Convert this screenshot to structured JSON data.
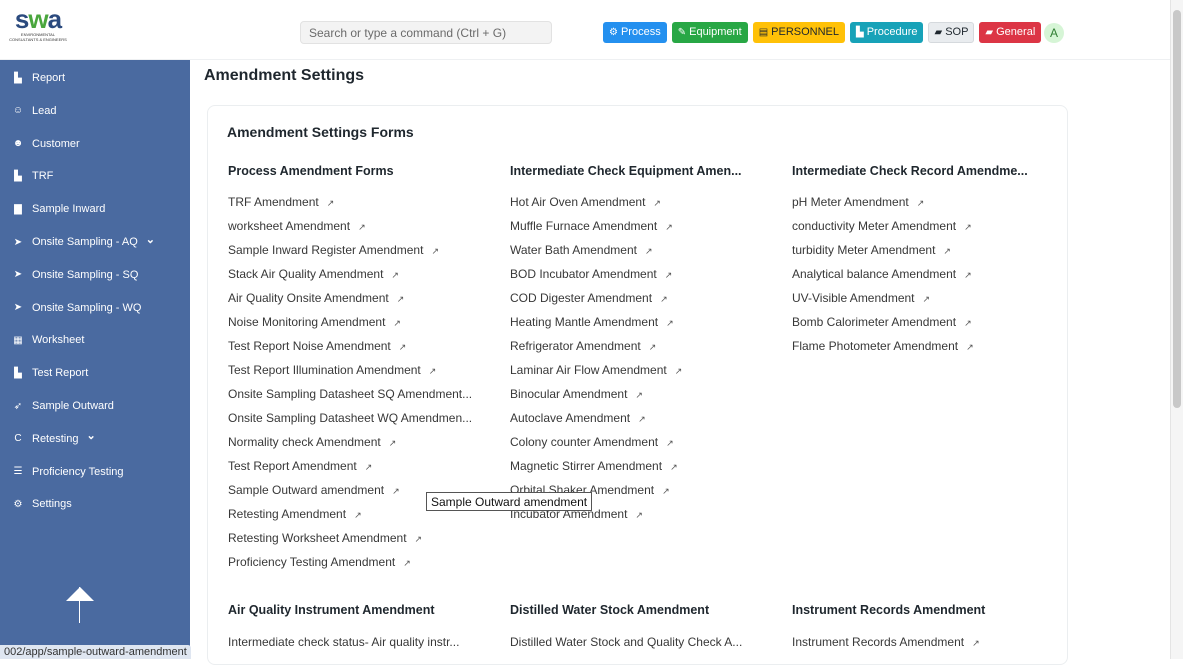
{
  "logo": {
    "brand_s": "s",
    "brand_w": "w",
    "brand_a": "a",
    "sub": "ENVIRONMENTAL CONSULTANTS & ENGINEERS"
  },
  "search": {
    "placeholder": "Search or type a command (Ctrl + G)"
  },
  "quick_buttons": [
    {
      "label": "Process",
      "icon": "gears-icon",
      "bg": "#2490ef",
      "fg": "#ffffff"
    },
    {
      "label": "Equipment",
      "icon": "wrench-icon",
      "bg": "#28a745",
      "fg": "#ffffff"
    },
    {
      "label": "PERSONNEL",
      "icon": "id-card-icon",
      "bg": "#ffc107",
      "fg": "#1f272e"
    },
    {
      "label": "Procedure",
      "icon": "file-icon",
      "bg": "#17a2b8",
      "fg": "#ffffff"
    },
    {
      "label": "SOP",
      "icon": "book-icon",
      "bg": "#e9ecef",
      "fg": "#1f272e"
    },
    {
      "label": "General",
      "icon": "book-icon",
      "bg": "#dc3545",
      "fg": "#ffffff"
    }
  ],
  "avatar": "A",
  "sidebar": {
    "items": [
      {
        "label": "Report",
        "icon": "file-icon"
      },
      {
        "label": "Lead",
        "icon": "user-plus-icon"
      },
      {
        "label": "Customer",
        "icon": "users-icon"
      },
      {
        "label": "TRF",
        "icon": "file-icon"
      },
      {
        "label": "Sample Inward",
        "icon": "archive-icon"
      },
      {
        "label": "Onsite Sampling - AQ",
        "icon": "location-arrow-icon",
        "caret": "⌄"
      },
      {
        "label": "Onsite Sampling - SQ",
        "icon": "location-arrow-icon"
      },
      {
        "label": "Onsite Sampling - WQ",
        "icon": "location-arrow-icon"
      },
      {
        "label": "Worksheet",
        "icon": "table-icon"
      },
      {
        "label": "Test Report",
        "icon": "file-icon"
      },
      {
        "label": "Sample Outward",
        "icon": "send-icon"
      },
      {
        "label": "Retesting",
        "icon": "refresh-icon",
        "caret": "⌄"
      },
      {
        "label": "Proficiency Testing",
        "icon": "list-icon"
      },
      {
        "label": "Settings",
        "icon": "gears-icon"
      }
    ]
  },
  "main": {
    "page_title": "Amendment Settings",
    "card_title": "Amendment Settings Forms",
    "columns": [
      {
        "heading": "Process Amendment Forms",
        "links": [
          {
            "label": "TRF Amendment",
            "arrow": "↗"
          },
          {
            "label": "worksheet Amendment",
            "arrow": "↗"
          },
          {
            "label": "Sample Inward Register Amendment",
            "arrow": "↗"
          },
          {
            "label": "Stack Air Quality Amendment",
            "arrow": "↗"
          },
          {
            "label": "Air Quality Onsite Amendment",
            "arrow": "↗"
          },
          {
            "label": "Noise Monitoring Amendment",
            "arrow": "↗"
          },
          {
            "label": "Test Report Noise Amendment",
            "arrow": "↗"
          },
          {
            "label": "Test Report Illumination Amendment",
            "arrow": "↗"
          },
          {
            "label": "Onsite Sampling Datasheet SQ Amendment...",
            "arrow": ""
          },
          {
            "label": "Onsite Sampling Datasheet WQ Amendmen...",
            "arrow": ""
          },
          {
            "label": "Normality check Amendment",
            "arrow": "↗"
          },
          {
            "label": "Test Report Amendment",
            "arrow": "↗"
          },
          {
            "label": "Sample Outward amendment",
            "arrow": "↗"
          },
          {
            "label": "Retesting Amendment",
            "arrow": "↗"
          },
          {
            "label": "Retesting Worksheet Amendment",
            "arrow": "↗"
          },
          {
            "label": "Proficiency Testing Amendment",
            "arrow": "↗"
          }
        ]
      },
      {
        "heading": "Intermediate Check Equipment Amen...",
        "links": [
          {
            "label": "Hot Air Oven Amendment",
            "arrow": "↗"
          },
          {
            "label": "Muffle Furnace Amendment",
            "arrow": "↗"
          },
          {
            "label": "Water Bath Amendment",
            "arrow": "↗"
          },
          {
            "label": "BOD Incubator Amendment",
            "arrow": "↗"
          },
          {
            "label": "COD Digester Amendment",
            "arrow": "↗"
          },
          {
            "label": "Heating Mantle Amendment",
            "arrow": "↗"
          },
          {
            "label": "Refrigerator Amendment",
            "arrow": "↗"
          },
          {
            "label": "Laminar Air Flow Amendment",
            "arrow": "↗"
          },
          {
            "label": "Binocular Amendment",
            "arrow": "↗"
          },
          {
            "label": "Autoclave Amendment",
            "arrow": "↗"
          },
          {
            "label": "Colony counter Amendment",
            "arrow": "↗"
          },
          {
            "label": "Magnetic Stirrer Amendment",
            "arrow": "↗"
          },
          {
            "label": "Orbital Shaker Amendment",
            "arrow": "↗"
          },
          {
            "label": "Incubator Amendment",
            "arrow": "↗"
          }
        ]
      },
      {
        "heading": "Intermediate Check Record Amendme...",
        "links": [
          {
            "label": "pH Meter Amendment",
            "arrow": "↗"
          },
          {
            "label": "conductivity Meter Amendment",
            "arrow": "↗"
          },
          {
            "label": "turbidity Meter Amendment",
            "arrow": "↗"
          },
          {
            "label": "Analytical balance Amendment",
            "arrow": "↗"
          },
          {
            "label": "UV-Visible Amendment",
            "arrow": "↗"
          },
          {
            "label": "Bomb Calorimeter Amendment",
            "arrow": "↗"
          },
          {
            "label": "Flame Photometer Amendment",
            "arrow": "↗"
          }
        ]
      }
    ],
    "bottom_columns": [
      {
        "heading": "Air Quality Instrument Amendment",
        "links": [
          {
            "label": "Intermediate check status- Air quality instr...",
            "arrow": ""
          }
        ]
      },
      {
        "heading": "Distilled Water Stock Amendment",
        "links": [
          {
            "label": "Distilled Water Stock and Quality Check A...",
            "arrow": ""
          }
        ]
      },
      {
        "heading": "Instrument Records Amendment",
        "links": [
          {
            "label": "Instrument Records Amendment",
            "arrow": "↗"
          }
        ]
      }
    ]
  },
  "tooltip": "Sample Outward amendment",
  "status_url": "002/app/sample-outward-amendment"
}
